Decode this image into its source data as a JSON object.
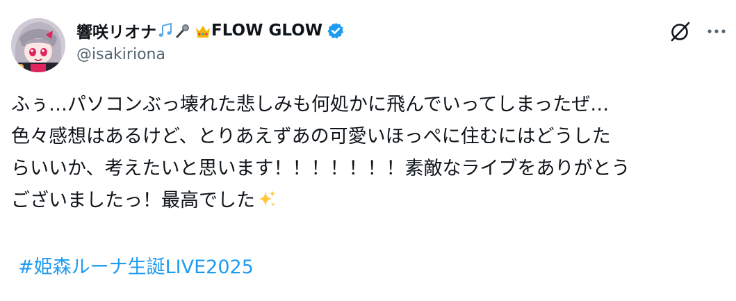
{
  "author": {
    "display_name": "響咲リオナ",
    "display_name_suffix": "FLOW GLOW",
    "handle": "@isakiriona",
    "verified": true,
    "name_emojis": [
      "notes-emoji",
      "microphone-emoji",
      "crown-emoji"
    ]
  },
  "tweet": {
    "text": "ふぅ…パソコンぶっ壊れた悲しみも何処かに飛んでいってしまったぜ…\n色々感想はあるけど、とりあえずあの可愛いほっぺに住むにはどうした\nらいいか、考えたいと思います！！！！！！！素敵なライブをありがとう\nございましたっ！最高でした",
    "text_end_emoji": "sparkles-emoji",
    "hashtag": "#姫森ルーナ生誕LIVE2025"
  },
  "actions": {
    "grok_icon": "grok-icon",
    "more_icon": "more-icon"
  },
  "colors": {
    "text": "#0f1419",
    "secondary": "#536471",
    "link": "#1d9bf0",
    "verified": "#1d9bf0"
  }
}
